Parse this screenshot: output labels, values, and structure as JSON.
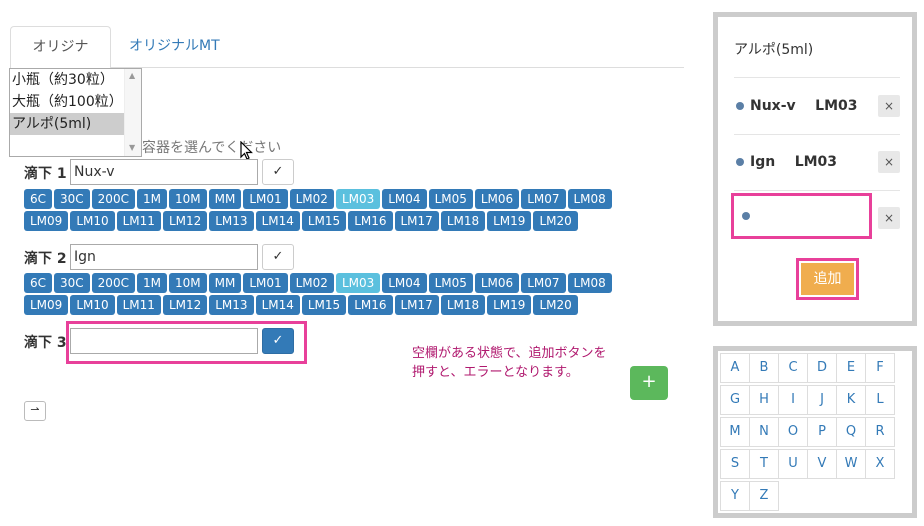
{
  "tabs": [
    {
      "label": "オリジナル",
      "active": true
    },
    {
      "label": "オリジナルMT",
      "active": false
    }
  ],
  "container_select": {
    "options": [
      "小瓶（約30粒）",
      "大瓶（約100粒）",
      "アルポ(5ml)"
    ],
    "selected_index": 2,
    "hint": "容器を選んでください"
  },
  "doses": [
    {
      "label": "滴下 1",
      "value": "Nux-v",
      "check": "✓",
      "active_potency": "LM03"
    },
    {
      "label": "滴下 2",
      "value": "Ign",
      "check": "✓",
      "active_potency": "LM03"
    },
    {
      "label": "滴下 3",
      "value": "",
      "check": "✓"
    }
  ],
  "potencies_row1": [
    "6C",
    "30C",
    "200C",
    "1M",
    "10M",
    "MM",
    "LM01",
    "LM02",
    "LM03",
    "LM04",
    "LM05",
    "LM06",
    "LM07",
    "LM08"
  ],
  "potencies_row2": [
    "LM09",
    "LM10",
    "LM11",
    "LM12",
    "LM13",
    "LM14",
    "LM15",
    "LM16",
    "LM17",
    "LM18",
    "LM19",
    "LM20"
  ],
  "error_note": {
    "line1": "空欄がある状態で、追加ボタンを",
    "line2": "押すと、エラーとなります。"
  },
  "add_row_label": "+",
  "toggle_label": "⇀",
  "panel": {
    "title": "アルポ(5ml)",
    "items": [
      {
        "name": "Nux-v",
        "potency": "LM03",
        "remove": "×"
      },
      {
        "name": "Ign",
        "potency": "LM03",
        "remove": "×"
      }
    ],
    "empty_remove": "×",
    "add_label": "追加"
  },
  "keyboard": [
    "A",
    "B",
    "C",
    "D",
    "E",
    "F",
    "G",
    "H",
    "I",
    "J",
    "K",
    "L",
    "M",
    "N",
    "O",
    "P",
    "Q",
    "R",
    "S",
    "T",
    "U",
    "V",
    "W",
    "X",
    "Y",
    "Z"
  ],
  "colors": {
    "primary": "#337ab7",
    "active_potency": "#5bc0de",
    "highlight": "#e8409a",
    "add": "#f0ad4e",
    "plus": "#5cb85c",
    "note": "#b0186e"
  }
}
